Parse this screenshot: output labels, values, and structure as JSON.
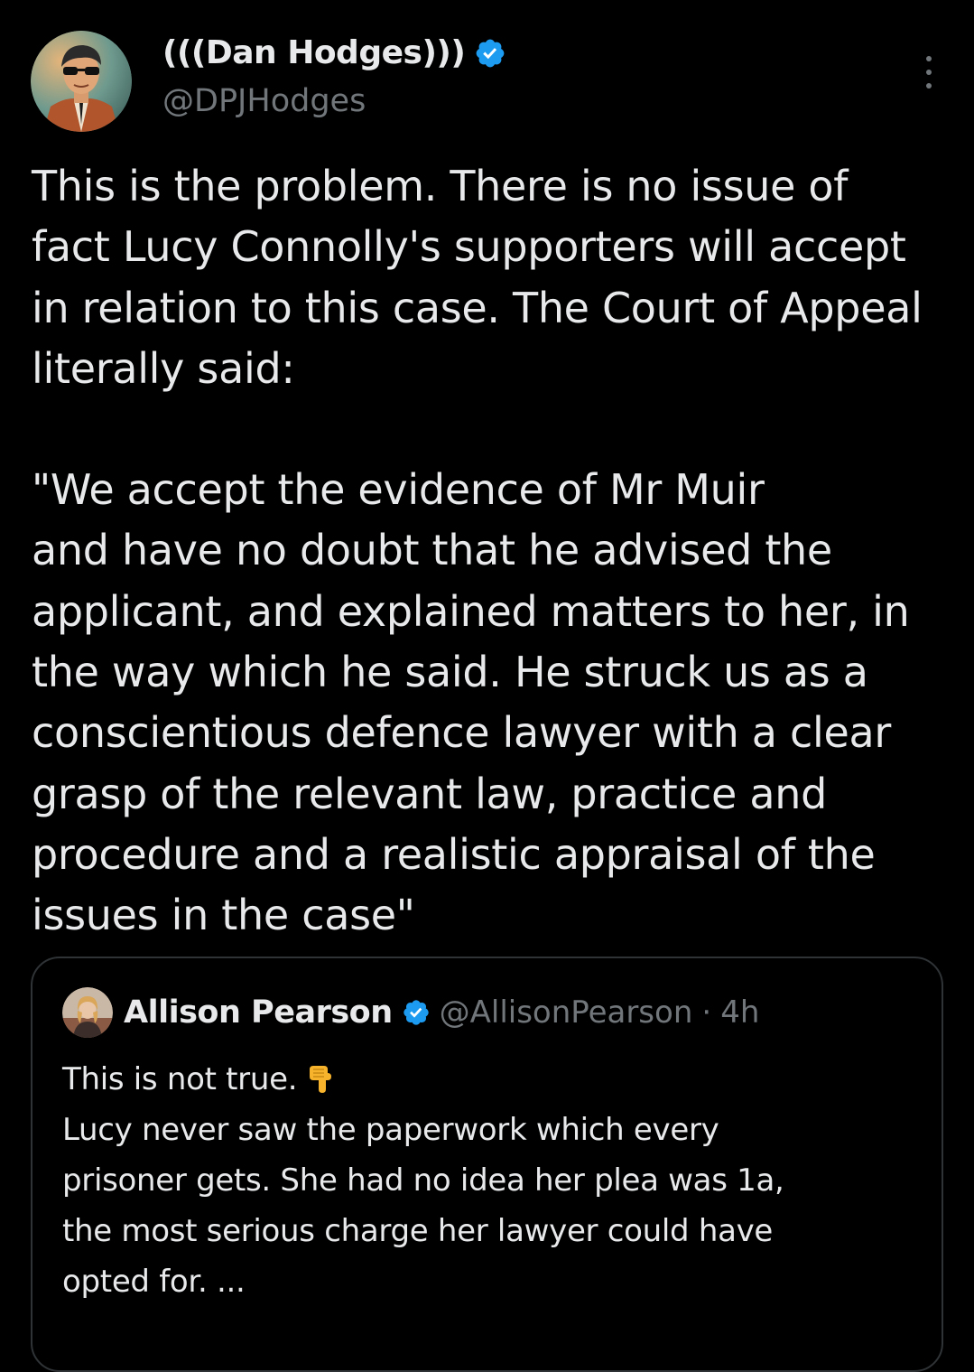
{
  "tweet": {
    "author": {
      "display_name": "(((Dan Hodges)))",
      "handle": "@DPJHodges",
      "verified": true
    },
    "more_icon": "more-options-icon",
    "text_paragraphs": [
      "This is the problem. There is no issue of\nfact Lucy Connolly's supporters will accept\nin relation to this case. The Court of Appeal\nliterally said:",
      "\"We accept the evidence of Mr Muir\nand have no doubt that he advised the\napplicant, and explained matters to her, in\nthe way which he said. He struck us as a\nconscientious defence lawyer with a clear\ngrasp of the relevant law, practice and\nprocedure and a realistic appraisal of the\nissues in the case\""
    ]
  },
  "quoted_tweet": {
    "author": {
      "display_name": "Allison Pearson",
      "handle": "@AllisonPearson",
      "separator": "·",
      "time": "4h",
      "verified": true
    },
    "lines": [
      "This is not true.",
      "Lucy never saw the paperwork which every",
      "prisoner gets. She had no idea her plea was 1a,",
      "the most serious charge her lawyer could have",
      "opted for.  ..."
    ],
    "emoji": "backhand-index-pointing-down"
  },
  "colors": {
    "background": "#000000",
    "text": "#e7e9ea",
    "secondary_text": "#71767b",
    "verified_badge": "#1d9bf0",
    "border": "#2f3336"
  }
}
